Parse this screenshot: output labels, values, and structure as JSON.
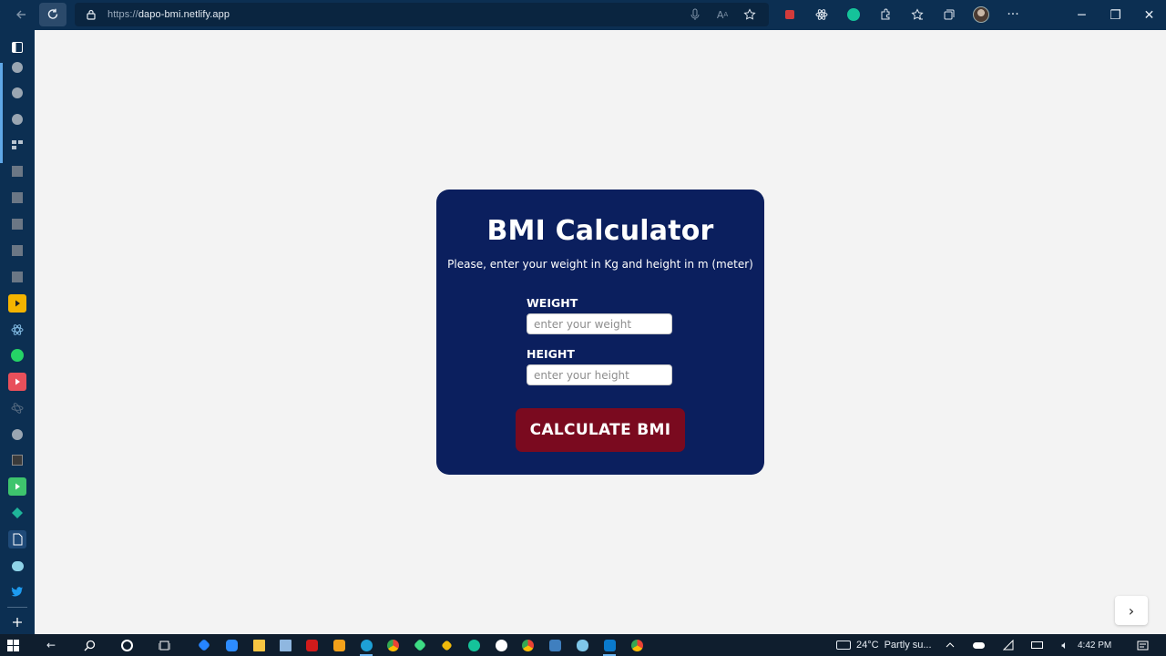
{
  "browser": {
    "url_protocol": "https://",
    "url_host": "dapo-bmi.netlify.app",
    "icons": {
      "back": "back-arrow-icon",
      "reload": "reload-icon",
      "lock": "lock-icon",
      "mic": "microphone-icon",
      "read_aloud": "read-aloud-icon",
      "favorite": "add-favorite-icon",
      "extensions": [
        "record-icon",
        "react-devtools-icon",
        "grammarly-icon",
        "extensions-puzzle-icon"
      ],
      "favorites": "favorites-icon",
      "collections": "collections-icon",
      "profile": "profile-avatar",
      "more": "more-icon"
    },
    "window_controls": {
      "minimize": "─",
      "restore": "❐",
      "close": "✕"
    }
  },
  "sidebar": {
    "accent_color": "#5fa8e8",
    "items": [
      "tab-actions-icon",
      "chrome-app-icon",
      "chrome-app-icon",
      "chrome-app-icon",
      "tools-icon",
      "app-icon",
      "app-icon",
      "app-icon",
      "app-icon",
      "app-icon",
      "youtube-icon",
      "react-icon",
      "whatsapp-icon",
      "youtube-icon",
      "react-icon",
      "chrome-app-icon",
      "app-icon",
      "play-icon",
      "diamond-icon",
      "page-icon",
      "chat-icon",
      "twitter-icon",
      "add-icon"
    ]
  },
  "app": {
    "title": "BMI Calculator",
    "instructions": "Please, enter your weight in Kg and height in m (meter)",
    "weight_label": "WEIGHT",
    "weight_placeholder": "enter your weight",
    "weight_value": "",
    "height_label": "HEIGHT",
    "height_placeholder": "enter your height",
    "height_value": "",
    "button_label": "CALCULATE BMI",
    "colors": {
      "card": "#0b1f5e",
      "button": "#7a0a1f",
      "background": "#f3f3f3"
    }
  },
  "next_button": "›",
  "taskbar": {
    "apps": [
      "start-icon",
      "back-icon",
      "search-icon",
      "cortana-icon",
      "task-view-icon",
      "sourcetree-icon",
      "zoom-icon",
      "file-explorer-icon",
      "notepad-icon",
      "acrobat-icon",
      "vlc-icon",
      "edge-icon",
      "chrome-icon",
      "android-studio-icon",
      "binance-icon",
      "grammarly-icon",
      "app-icon",
      "chrome-icon",
      "edge-dev-icon",
      "chat-icon",
      "vscode-icon",
      "chrome-icon"
    ],
    "weather_temp": "24°C",
    "weather_text": "Partly su...",
    "time": "4:42 PM"
  }
}
